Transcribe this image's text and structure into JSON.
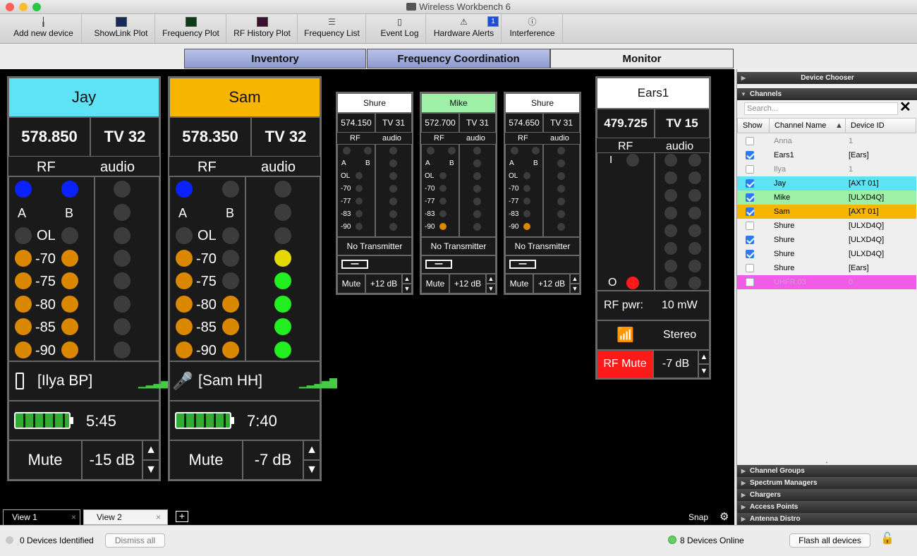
{
  "window": {
    "title": "Wireless Workbench 6"
  },
  "toolbar": {
    "add_device": "Add new device",
    "showlink_plot": "ShowLink Plot",
    "frequency_plot": "Frequency Plot",
    "rf_history_plot": "RF History Plot",
    "frequency_list": "Frequency List",
    "event_log": "Event Log",
    "hardware_alerts": "Hardware Alerts",
    "hardware_alerts_badge": "1",
    "interference": "Interference"
  },
  "tabs": {
    "inventory": "Inventory",
    "frequency_coordination": "Frequency Coordination",
    "monitor": "Monitor"
  },
  "big_channels": [
    {
      "name": "Jay",
      "color": "#5ee3f6",
      "freq": "578.850",
      "tv": "TV 32",
      "rf": "RF",
      "audio": "audio",
      "device": "[Ilya BP]",
      "battery": "5:45",
      "mute": "Mute",
      "gain": "-15 dB"
    },
    {
      "name": "Sam",
      "color": "#f7b500",
      "freq": "578.350",
      "tv": "TV 32",
      "rf": "RF",
      "audio": "audio",
      "device": "[Sam HH]",
      "battery": "7:40",
      "mute": "Mute",
      "gain": "-7 dB"
    }
  ],
  "meter_labels": {
    "a": "A",
    "b": "B",
    "ol": "OL",
    "m70": "-70",
    "m75": "-75",
    "m80": "-80",
    "m85": "-85",
    "m90": "-90",
    "m77": "-77",
    "m83": "-83"
  },
  "small_channels": [
    {
      "name": "Shure",
      "color": "#ffffff",
      "freq": "574.150",
      "tv": "TV 31",
      "rf": "RF",
      "audio": "audio",
      "status": "No Transmitter",
      "mute": "Mute",
      "gain": "+12 dB"
    },
    {
      "name": "Mike",
      "color": "#9ef0a6",
      "freq": "572.700",
      "tv": "TV 31",
      "rf": "RF",
      "audio": "audio",
      "status": "No Transmitter",
      "mute": "Mute",
      "gain": "+12 dB"
    },
    {
      "name": "Shure",
      "color": "#ffffff",
      "freq": "574.650",
      "tv": "TV 31",
      "rf": "RF",
      "audio": "audio",
      "status": "No Transmitter",
      "mute": "Mute",
      "gain": "+12 dB"
    }
  ],
  "ears": {
    "name": "Ears1",
    "freq": "479.725",
    "tv": "TV 15",
    "rf": "RF",
    "audio": "audio",
    "i": "I",
    "o": "O",
    "rf_pwr_label": "RF pwr:",
    "rf_pwr": "10 mW",
    "mode": "Stereo",
    "rf_mute": "RF Mute",
    "gain": "-7 dB"
  },
  "sidebar": {
    "device_chooser": "Device Chooser",
    "channels": "Channels",
    "search_placeholder": "Search...",
    "col_show": "Show",
    "col_name": "Channel Name",
    "col_id": "Device ID",
    "rows": [
      {
        "name": "Anna",
        "id": "1",
        "checked": false,
        "color": "#ffffff",
        "dim": true
      },
      {
        "name": "Ears1",
        "id": "[Ears]",
        "checked": true,
        "color": "#ffffff",
        "dim": false
      },
      {
        "name": "Ilya",
        "id": "1",
        "checked": false,
        "color": "#ffffff",
        "dim": true
      },
      {
        "name": "Jay",
        "id": "[AXT 01]",
        "checked": true,
        "color": "#5ee3f6",
        "dim": false
      },
      {
        "name": "Mike",
        "id": "[ULXD4Q]",
        "checked": true,
        "color": "#9ef0a6",
        "dim": false
      },
      {
        "name": "Sam",
        "id": "[AXT 01]",
        "checked": true,
        "color": "#f7b500",
        "dim": false
      },
      {
        "name": "Shure",
        "id": "[ULXD4Q]",
        "checked": false,
        "color": "#ffffff",
        "dim": false
      },
      {
        "name": "Shure",
        "id": "[ULXD4Q]",
        "checked": true,
        "color": "#ffffff",
        "dim": false
      },
      {
        "name": "Shure",
        "id": "[ULXD4Q]",
        "checked": true,
        "color": "#ffffff",
        "dim": false
      },
      {
        "name": "Shure",
        "id": "[Ears]",
        "checked": false,
        "color": "#ffffff",
        "dim": false
      },
      {
        "name": "UHFR.03",
        "id": "0",
        "checked": false,
        "color": "#f05ce8",
        "dim": true
      }
    ],
    "channel_groups": "Channel Groups",
    "spectrum_managers": "Spectrum Managers",
    "chargers": "Chargers",
    "access_points": "Access Points",
    "antenna_distro": "Antenna Distro"
  },
  "views": {
    "view1": "View 1",
    "view2": "View 2",
    "snap": "Snap"
  },
  "status": {
    "identified": "0 Devices Identified",
    "dismiss": "Dismiss all",
    "online": "8 Devices Online",
    "flash": "Flash all devices"
  }
}
